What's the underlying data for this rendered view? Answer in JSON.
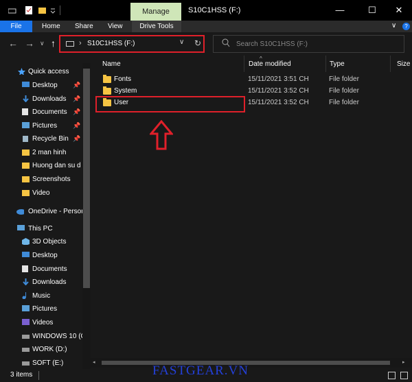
{
  "title_bar": {
    "contextual_tab": "Manage",
    "window_title": "S10C1HSS (F:)",
    "minimize": "—",
    "maximize": "☐",
    "close": "✕"
  },
  "ribbon": {
    "tabs": [
      "File",
      "Home",
      "Share",
      "View",
      "Drive Tools"
    ],
    "collapse": "∨",
    "help": "?"
  },
  "nav": {
    "back": "←",
    "forward": "→",
    "recent": "∨",
    "up": "↑",
    "address_path": "S10C1HSS (F:)",
    "address_chevron": "›",
    "address_dropdown": "∨",
    "refresh": "↻",
    "search_placeholder": "Search S10C1HSS (F:)"
  },
  "sidebar": {
    "quick_access": {
      "label": "Quick access",
      "items": [
        {
          "label": "Desktop",
          "icon": "desktop-icon",
          "pinned": true
        },
        {
          "label": "Downloads",
          "icon": "download-icon",
          "pinned": true
        },
        {
          "label": "Documents",
          "icon": "documents-icon",
          "pinned": true
        },
        {
          "label": "Pictures",
          "icon": "pictures-icon",
          "pinned": true
        },
        {
          "label": "Recycle Bin",
          "icon": "recycle-bin-icon",
          "pinned": true
        },
        {
          "label": "2 man hinh",
          "icon": "folder-icon",
          "pinned": false
        },
        {
          "label": "Huong dan su d",
          "icon": "folder-icon",
          "pinned": false
        },
        {
          "label": "Screenshots",
          "icon": "folder-icon",
          "pinned": false
        },
        {
          "label": "Video",
          "icon": "folder-icon",
          "pinned": false
        }
      ]
    },
    "onedrive": {
      "label": "OneDrive - Persor"
    },
    "this_pc": {
      "label": "This PC",
      "items": [
        {
          "label": "3D Objects",
          "icon": "3d-objects-icon"
        },
        {
          "label": "Desktop",
          "icon": "desktop-icon"
        },
        {
          "label": "Documents",
          "icon": "documents-icon"
        },
        {
          "label": "Downloads",
          "icon": "download-icon"
        },
        {
          "label": "Music",
          "icon": "music-icon"
        },
        {
          "label": "Pictures",
          "icon": "pictures-icon"
        },
        {
          "label": "Videos",
          "icon": "videos-icon"
        },
        {
          "label": "WINDOWS 10 (C",
          "icon": "drive-icon"
        },
        {
          "label": "WORK (D:)",
          "icon": "drive-icon"
        },
        {
          "label": "SOFT (E:)",
          "icon": "drive-icon"
        }
      ]
    }
  },
  "columns": [
    "Name",
    "Date modified",
    "Type",
    "Size"
  ],
  "files": [
    {
      "name": "Fonts",
      "date": "15/11/2021 3:51 CH",
      "type": "File folder"
    },
    {
      "name": "System",
      "date": "15/11/2021 3:52 CH",
      "type": "File folder"
    },
    {
      "name": "User",
      "date": "15/11/2021 3:52 CH",
      "type": "File folder"
    }
  ],
  "status": {
    "item_count": "3 items"
  },
  "watermark": "FASTGEAR.VN",
  "colors": {
    "highlight": "#e0202a",
    "folder": "#f6c443",
    "file_tab": "#1a73e8",
    "manage_tab": "#cfe6b8",
    "watermark": "#2440d9"
  }
}
